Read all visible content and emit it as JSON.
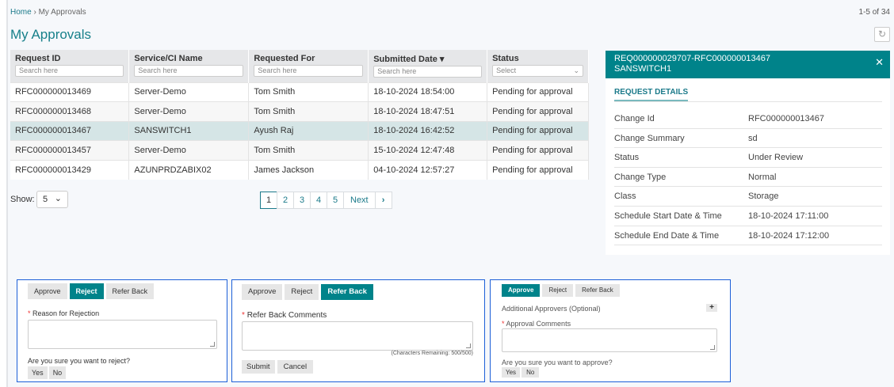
{
  "breadcrumb": {
    "home": "Home",
    "sep": "›",
    "current": "My Approvals"
  },
  "record_count": "1-5 of 34",
  "page_title": "My Approvals",
  "refresh_icon": "↻",
  "table": {
    "columns": [
      {
        "label": "Request ID",
        "placeholder": "Search here"
      },
      {
        "label": "Service/CI Name",
        "placeholder": "Search here"
      },
      {
        "label": "Requested For",
        "placeholder": "Search here"
      },
      {
        "label": "Submitted Date ▾",
        "placeholder": "Search here"
      },
      {
        "label": "Status",
        "placeholder": "Select"
      }
    ],
    "rows": [
      [
        "RFC000000013469",
        "Server-Demo",
        "Tom Smith",
        "18-10-2024 18:54:00",
        "Pending for approval"
      ],
      [
        "RFC000000013468",
        "Server-Demo",
        "Tom Smith",
        "18-10-2024 18:47:51",
        "Pending for approval"
      ],
      [
        "RFC000000013467",
        "SANSWITCH1",
        "Ayush Raj",
        "18-10-2024 16:42:52",
        "Pending for approval"
      ],
      [
        "RFC000000013457",
        "Server-Demo",
        "Tom Smith",
        "15-10-2024 12:47:48",
        "Pending for approval"
      ],
      [
        "RFC000000013429",
        "AZUNPRDZABIX02",
        "James Jackson",
        "04-10-2024 12:57:27",
        "Pending for approval"
      ]
    ],
    "selected_row": 2
  },
  "show": {
    "label": "Show:",
    "value": "5",
    "chevron": "⌄"
  },
  "pager": {
    "pages": [
      "1",
      "2",
      "3",
      "4",
      "5"
    ],
    "current": "1",
    "next": "Next",
    "next_icon": "›"
  },
  "detail": {
    "title": "REQ000000029707-RFC000000013467",
    "subtitle": "SANSWITCH1",
    "close": "✕",
    "tab": "REQUEST DETAILS",
    "fields": [
      {
        "label": "Change Id",
        "value": "RFC000000013467"
      },
      {
        "label": "Change Summary",
        "value": "sd"
      },
      {
        "label": "Status",
        "value": "Under Review"
      },
      {
        "label": "Change Type",
        "value": "Normal"
      },
      {
        "label": "Class",
        "value": "Storage"
      },
      {
        "label": "Schedule Start Date & Time",
        "value": "18-10-2024 17:11:00"
      },
      {
        "label": "Schedule End Date & Time",
        "value": "18-10-2024 17:12:00"
      }
    ]
  },
  "actions": {
    "approve": "Approve",
    "reject": "Reject",
    "refer_back": "Refer Back",
    "required": "*"
  },
  "reject_panel": {
    "label": "Reason for Rejection",
    "confirm": "Are you sure you want to reject?",
    "yes": "Yes",
    "no": "No"
  },
  "refer_panel": {
    "label": "Refer Back Comments",
    "chars": "(Characters Remaining: 500/500)",
    "submit": "Submit",
    "cancel": "Cancel"
  },
  "approve_panel": {
    "additional": "Additional Approvers (Optional)",
    "add_icon": "+",
    "label": "Approval Comments",
    "confirm": "Are you sure you want to approve?",
    "yes": "Yes",
    "no": "No"
  }
}
